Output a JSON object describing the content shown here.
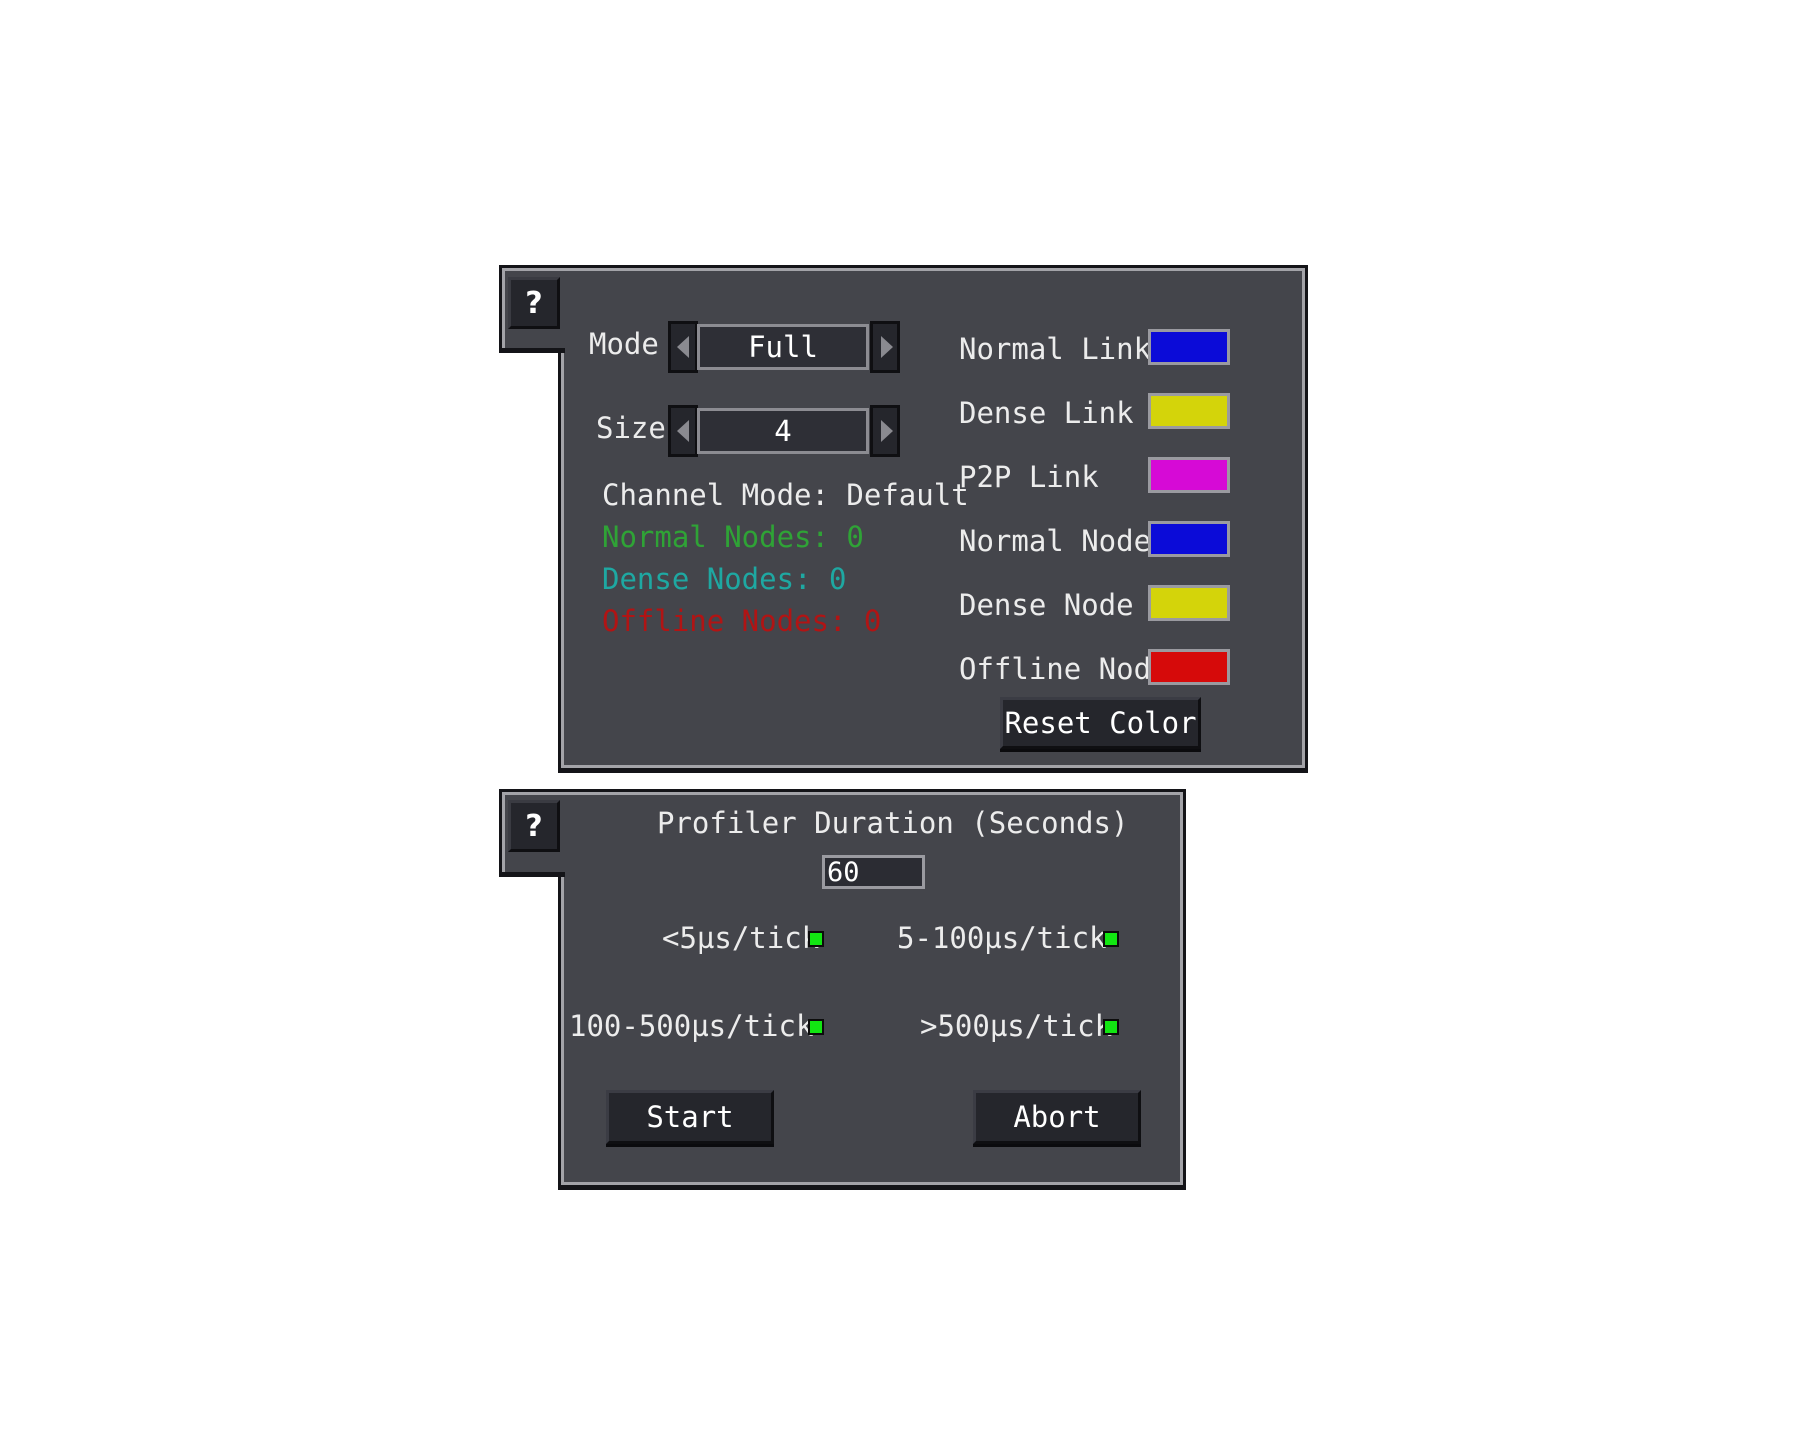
{
  "display_panel": {
    "help_label": "?",
    "mode": {
      "label": "Mode",
      "value": "Full"
    },
    "size": {
      "label": "Size",
      "value": "4"
    },
    "channel_mode": "Channel Mode: Default",
    "normal_nodes": "Normal Nodes: 0",
    "dense_nodes": "Dense Nodes: 0",
    "offline_nodes": "Offline Nodes: 0",
    "stat_colors": {
      "normal": "#2fa336",
      "dense": "#1ea8a2",
      "offline": "#b11414"
    },
    "colors": [
      {
        "label": "Normal Link",
        "color": "#0b0bd8"
      },
      {
        "label": "Dense Link",
        "color": "#d4d40a"
      },
      {
        "label": "P2P Link",
        "color": "#d60ad6"
      },
      {
        "label": "Normal Node",
        "color": "#0b0bd8"
      },
      {
        "label": "Dense Node",
        "color": "#d4d40a"
      },
      {
        "label": "Offline Node",
        "color": "#d60a0a"
      }
    ],
    "reset_label": "Reset Color"
  },
  "profiler_panel": {
    "help_label": "?",
    "title": "Profiler Duration (Seconds)",
    "duration_value": "60",
    "indicator_color": "#12e612",
    "thresholds": [
      "<5µs/tick",
      "5-100µs/tick",
      "100-500µs/tick",
      ">500µs/tick"
    ],
    "start_label": "Start",
    "abort_label": "Abort"
  }
}
